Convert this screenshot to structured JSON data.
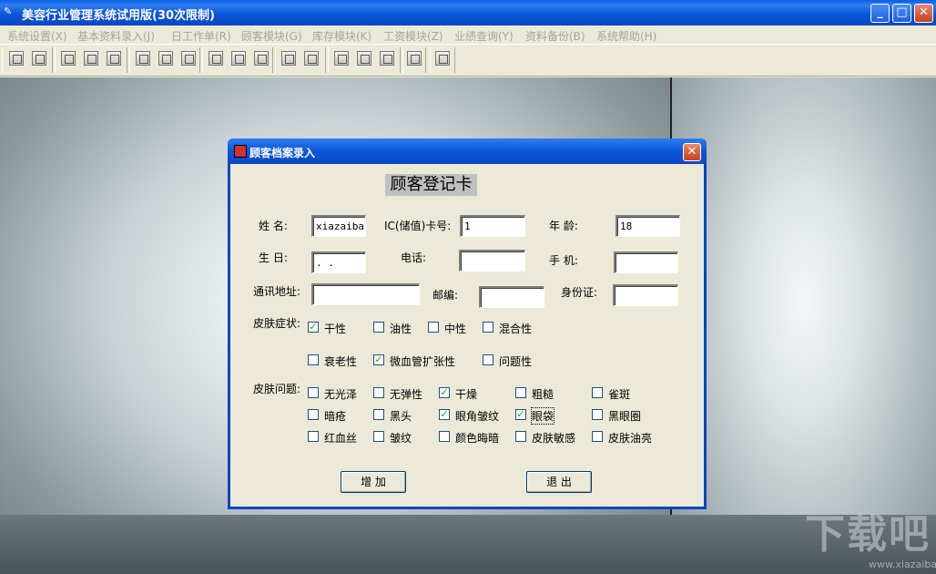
{
  "window": {
    "title": "美容行业管理系统试用版(30次限制)",
    "minimize_glyph": "_",
    "maximize_glyph": "□",
    "close_glyph": "✕"
  },
  "menu": [
    {
      "label": "系统设置(X)"
    },
    {
      "label": "基本资料录入(J)"
    },
    {
      "label": "日工作单(R)"
    },
    {
      "label": "顾客模块(G)"
    },
    {
      "label": "库存模块(K)"
    },
    {
      "label": "工资模块(Z)"
    },
    {
      "label": "业绩查询(Y)"
    },
    {
      "label": "资料备份(B)"
    },
    {
      "label": "系统帮助(H)"
    }
  ],
  "toolbar_icons": [
    "import-icon",
    "lock-icon",
    "return-icon",
    "edit-icon",
    "document-icon",
    "search-icon",
    "image-icon",
    "record-icon",
    "transfer-icon",
    "calculator-icon",
    "notes-icon",
    "hand-icon",
    "list-icon",
    "chart-icon",
    "stamp-icon",
    "tools-icon",
    "print-icon",
    "info-icon"
  ],
  "dialog": {
    "title": "顾客档案录入",
    "close_glyph": "✕",
    "heading": "顾客登记卡",
    "labels": {
      "name": "姓  名:",
      "ic_card": "IC(储值)卡号:",
      "age": "年    龄:",
      "birthday": "生  日:",
      "phone": "电话:",
      "mobile": "手  机:",
      "address": "通讯地址:",
      "postcode": "邮编:",
      "id_card": "身份证:",
      "skin_symptom": "皮肤症状:",
      "skin_problem": "皮肤问题:"
    },
    "fields": {
      "name": "xiazaiba",
      "ic_card": "1",
      "age": "18",
      "birthday": "  .  .",
      "phone": "",
      "mobile": "",
      "address": "",
      "postcode": "",
      "id_card": ""
    },
    "skin_symptoms": [
      {
        "label": "干性",
        "checked": true
      },
      {
        "label": "油性",
        "checked": false
      },
      {
        "label": "中性",
        "checked": false
      },
      {
        "label": "混合性",
        "checked": false
      },
      {
        "label": "衰老性",
        "checked": false
      },
      {
        "label": "微血管扩张性",
        "checked": true
      },
      {
        "label": "问题性",
        "checked": false
      }
    ],
    "skin_problems": [
      {
        "label": "无光泽",
        "checked": false
      },
      {
        "label": "无弹性",
        "checked": false
      },
      {
        "label": "干燥",
        "checked": true
      },
      {
        "label": "粗糙",
        "checked": false
      },
      {
        "label": "雀斑",
        "checked": false
      },
      {
        "label": "暗疮",
        "checked": false
      },
      {
        "label": "黑头",
        "checked": false
      },
      {
        "label": "眼角皱纹",
        "checked": true
      },
      {
        "label": "眼袋",
        "checked": true
      },
      {
        "label": "黑眼圈",
        "checked": false
      },
      {
        "label": "红血丝",
        "checked": false
      },
      {
        "label": "皱纹",
        "checked": false
      },
      {
        "label": "颜色晦暗",
        "checked": false
      },
      {
        "label": "皮肤敏感",
        "checked": false
      },
      {
        "label": "皮肤油亮",
        "checked": false
      }
    ],
    "buttons": {
      "add": "增  加",
      "exit": "退  出"
    }
  },
  "watermark": {
    "logo": "下载吧",
    "url": "www.xiazaiba.com"
  }
}
